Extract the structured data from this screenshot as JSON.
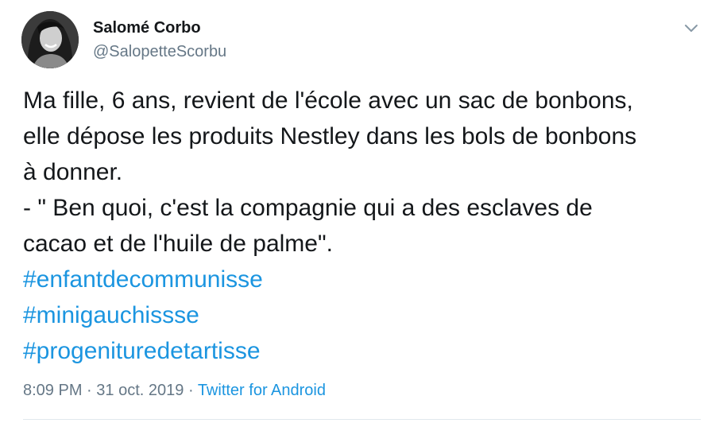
{
  "author": {
    "display_name": "Salomé Corbo",
    "handle": "@SalopetteScorbu",
    "avatar_icon": "profile-photo"
  },
  "menu": {
    "icon": "chevron-down-icon"
  },
  "tweet": {
    "lines": [
      "Ma fille, 6 ans, revient de l'école avec un sac de bonbons,",
      "elle dépose les produits Nestley dans les bols de bonbons",
      "à donner.",
      "- \" Ben quoi, c'est la compagnie qui a des esclaves de",
      "cacao et de l'huile de palme\"."
    ],
    "hashtags": [
      "#enfantdecommunisse",
      "#minigauchissse",
      "#progenituredetartisse"
    ]
  },
  "meta": {
    "time": "8:09 PM",
    "separator": "·",
    "date": "31 oct. 2019",
    "source": "Twitter for Android"
  },
  "colors": {
    "link": "#1b95e0",
    "muted": "#657786",
    "text": "#14171a"
  }
}
